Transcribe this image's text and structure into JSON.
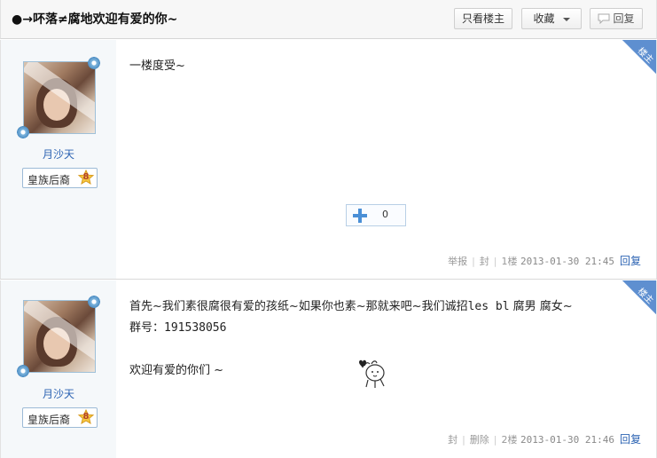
{
  "header": {
    "title": "●→吥落≠腐地欢迎有爱的你~",
    "only_op_label": "只看楼主",
    "favorite_label": "收藏",
    "reply_label": "回复"
  },
  "posts": [
    {
      "username": "月沙天",
      "badge_name": "皇族后裔",
      "badge_level": "8",
      "op_tag": "楼主",
      "lines": [
        "一楼度受~"
      ],
      "like_count": "0",
      "actions": [
        "举报",
        "封"
      ],
      "floor": "1楼",
      "timestamp": "2013-01-30 21:45",
      "reply_label": "回复"
    },
    {
      "username": "月沙天",
      "badge_name": "皇族后裔",
      "badge_level": "8",
      "op_tag": "楼主",
      "line1": "首先~我们素很腐很有爱的孩纸~如果你也素~那就来吧~我们诚招",
      "line1_tail": "les bl",
      "line1_end": " 腐男 腐女~",
      "group_label": "群号：",
      "group_number": "191538056",
      "welcome": "欢迎有爱的你们 ~",
      "actions": [
        "封",
        "删除"
      ],
      "floor": "2楼",
      "timestamp": "2013-01-30 21:46",
      "reply_label": "回复"
    }
  ],
  "colors": {
    "link_blue": "#2d64b3",
    "op_corner": "#5e8fd0",
    "sidebar_bg": "#f5f8fa",
    "like_plus": "#4a8fd6"
  }
}
